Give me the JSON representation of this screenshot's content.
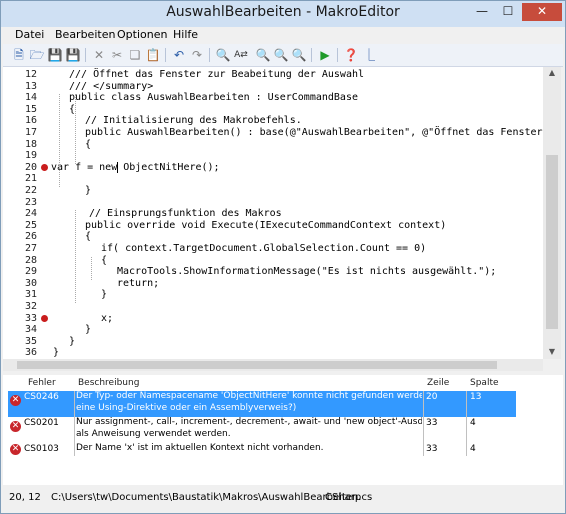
{
  "window": {
    "title": "AuswahlBearbeiten - MakroEditor"
  },
  "menu": {
    "items": [
      "Datei",
      "Bearbeiten",
      "Optionen",
      "Hilfe"
    ]
  },
  "toolbar": {
    "icons": [
      "new-icon",
      "open-icon",
      "save-icon",
      "save-all-icon",
      "delete-icon",
      "cut-icon",
      "copy-icon",
      "paste-icon",
      "undo-icon",
      "redo-icon",
      "find-icon",
      "replace-icon",
      "find-prev-icon",
      "find-next-icon",
      "find-all-icon",
      "run-icon",
      "help-icon",
      "info-icon"
    ]
  },
  "editor": {
    "lines": [
      {
        "n": "12",
        "code": "/// Öffnet das Fenster zur Beabeitung der Auswahl",
        "indent": 18,
        "bp": false
      },
      {
        "n": "13",
        "code": "/// </summary>",
        "indent": 18,
        "bp": false
      },
      {
        "n": "14",
        "code": "public class AuswahlBearbeiten : UserCommandBase",
        "indent": 18,
        "bp": false
      },
      {
        "n": "15",
        "code": "{",
        "indent": 18,
        "bp": false
      },
      {
        "n": "16",
        "code": "// Initialisierung des Makrobefehls.",
        "indent": 34,
        "bp": false
      },
      {
        "n": "17",
        "code": "public AuswahlBearbeiten() : base(@\"AuswahlBearbeiten\", @\"Öffnet das Fenster zur",
        "indent": 34,
        "bp": false
      },
      {
        "n": "18",
        "code": "{",
        "indent": 34,
        "bp": false
      },
      {
        "n": "19",
        "code": "",
        "indent": 34,
        "bp": false
      },
      {
        "n": "20",
        "code": "var f = new ObjectNitHere();",
        "indent": 0,
        "bp": true
      },
      {
        "n": "21",
        "code": "",
        "indent": 34,
        "bp": false
      },
      {
        "n": "22",
        "code": "}",
        "indent": 34,
        "bp": false
      },
      {
        "n": "23",
        "code": "",
        "indent": 34,
        "bp": false
      },
      {
        "n": "24",
        "code": "// Einsprungsfunktion des Makros",
        "indent": 38,
        "bp": false
      },
      {
        "n": "25",
        "code": "public override void Execute(IExecuteCommandContext context)",
        "indent": 34,
        "bp": false
      },
      {
        "n": "26",
        "code": "{",
        "indent": 34,
        "bp": false
      },
      {
        "n": "27",
        "code": "if( context.TargetDocument.GlobalSelection.Count == 0)",
        "indent": 50,
        "bp": false
      },
      {
        "n": "28",
        "code": "{",
        "indent": 50,
        "bp": false
      },
      {
        "n": "29",
        "code": "MacroTools.ShowInformationMessage(\"Es ist nichts ausgewählt.\");",
        "indent": 66,
        "bp": false
      },
      {
        "n": "30",
        "code": "return;",
        "indent": 66,
        "bp": false
      },
      {
        "n": "31",
        "code": "}",
        "indent": 50,
        "bp": false
      },
      {
        "n": "32",
        "code": "",
        "indent": 50,
        "bp": false
      },
      {
        "n": "33",
        "code": "x;",
        "indent": 50,
        "bp": true
      },
      {
        "n": "34",
        "code": "}",
        "indent": 34,
        "bp": false
      },
      {
        "n": "35",
        "code": "}",
        "indent": 18,
        "bp": false
      },
      {
        "n": "36",
        "code": "}",
        "indent": 2,
        "bp": false
      }
    ]
  },
  "errors": {
    "headers": {
      "code": "Fehler",
      "desc": "Beschreibung",
      "line": "Zeile",
      "col": "Spalte"
    },
    "rows": [
      {
        "code": "CS0246",
        "desc1": "Der Typ- oder Namespacename 'ObjectNitHere' konnte nicht gefunden werden. (Fehlt",
        "desc2": "eine Using-Direktive oder ein Assemblyverweis?)",
        "line": "20",
        "col": "13",
        "selected": true
      },
      {
        "code": "CS0201",
        "desc1": "Nur assignment-, call-, increment-, decrement-, await- und 'new object'-Ausdrücke können",
        "desc2": "als Anweisung verwendet werden.",
        "line": "33",
        "col": "4",
        "selected": false
      },
      {
        "code": "CS0103",
        "desc1": "Der Name 'x' ist im aktuellen Kontext nicht vorhanden.",
        "desc2": "",
        "line": "33",
        "col": "4",
        "selected": false
      }
    ]
  },
  "status": {
    "position": "20, 12",
    "path": "C:\\Users\\tw\\Documents\\Baustatik\\Makros\\AuswahlBearbeiten.cs",
    "language": "CSharp"
  }
}
